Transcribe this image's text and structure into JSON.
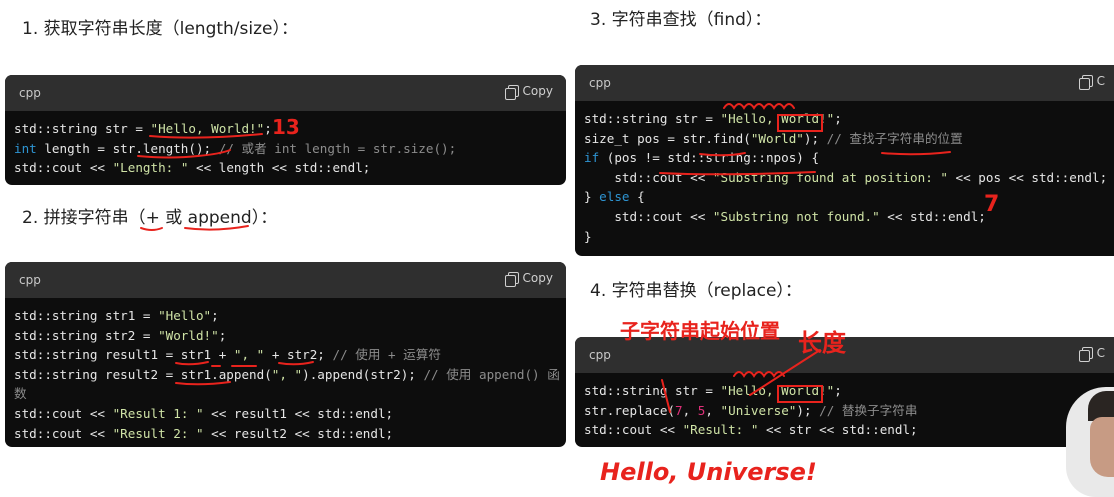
{
  "sections": [
    {
      "heading": "1. 获取字符串长度（length/size）：",
      "lang": "cpp",
      "copy": "Copy",
      "lines": [
        [
          [
            "std::string str = ",
            ""
          ],
          [
            "\"Hello, World!\"",
            "s2"
          ],
          [
            ";",
            ""
          ]
        ],
        [
          [
            "int",
            "kw"
          ],
          [
            " length = str.length(); ",
            ""
          ],
          [
            "// 或者 int length = str.size();",
            "cm"
          ]
        ],
        [
          [
            "std::cout << ",
            ""
          ],
          [
            "\"Length: \"",
            "s2"
          ],
          [
            " << length << std::endl;",
            ""
          ]
        ]
      ]
    },
    {
      "heading": "2. 拼接字符串（+ 或 append）：",
      "lang": "cpp",
      "copy": "Copy",
      "lines": [
        [
          [
            "std::string str1 = ",
            ""
          ],
          [
            "\"Hello\"",
            "s2"
          ],
          [
            ";",
            ""
          ]
        ],
        [
          [
            "std::string str2 = ",
            ""
          ],
          [
            "\"World!\"",
            "s2"
          ],
          [
            ";",
            ""
          ]
        ],
        [
          [
            "std::string result1 = str1 + ",
            ""
          ],
          [
            "\", \"",
            "s2"
          ],
          [
            " + str2; ",
            ""
          ],
          [
            "// 使用 + 运算符",
            "cm"
          ]
        ],
        [
          [
            "std::string result2 = str1.append(",
            ""
          ],
          [
            "\", \"",
            "s2"
          ],
          [
            ").append(str2); ",
            ""
          ],
          [
            "// 使用 append() 函",
            "cm"
          ]
        ],
        [
          [
            "数",
            "cm"
          ]
        ],
        [
          [
            "std::cout << ",
            ""
          ],
          [
            "\"Result 1: \"",
            "s2"
          ],
          [
            " << result1 << std::endl;",
            ""
          ]
        ],
        [
          [
            "std::cout << ",
            ""
          ],
          [
            "\"Result 2: \"",
            "s2"
          ],
          [
            " << result2 << std::endl;",
            ""
          ]
        ]
      ]
    },
    {
      "heading": "3. 字符串查找（find）：",
      "lang": "cpp",
      "copy": "C",
      "lines": [
        [
          [
            "std::string str = ",
            ""
          ],
          [
            "\"Hello, World!\"",
            "s2"
          ],
          [
            ";",
            ""
          ]
        ],
        [
          [
            "size_t pos = str.find(",
            ""
          ],
          [
            "\"World\"",
            "s2"
          ],
          [
            "); ",
            ""
          ],
          [
            "// 查找子字符串的位置",
            "cm"
          ]
        ],
        [
          [
            "if",
            "kw"
          ],
          [
            " (pos != std::string::npos) {",
            ""
          ]
        ],
        [
          [
            "    std::cout << ",
            ""
          ],
          [
            "\"Substring found at position: \"",
            "s2"
          ],
          [
            " << pos << std::endl;",
            ""
          ]
        ],
        [
          [
            "} ",
            ""
          ],
          [
            "else",
            "kw"
          ],
          [
            " {",
            ""
          ]
        ],
        [
          [
            "    std::cout << ",
            ""
          ],
          [
            "\"Substring not found.\"",
            "s2"
          ],
          [
            " << std::endl;",
            ""
          ]
        ],
        [
          [
            "}",
            ""
          ]
        ]
      ]
    },
    {
      "heading": "4. 字符串替换（replace）：",
      "lang": "cpp",
      "copy": "C",
      "lines": [
        [
          [
            "std::string str = ",
            ""
          ],
          [
            "\"Hello, World!\"",
            "s2"
          ],
          [
            ";",
            ""
          ]
        ],
        [
          [
            "str.replace(",
            ""
          ],
          [
            "7",
            "num"
          ],
          [
            ", ",
            ""
          ],
          [
            "5",
            "num"
          ],
          [
            ", ",
            ""
          ],
          [
            "\"Universe\"",
            "s2"
          ],
          [
            "); ",
            ""
          ],
          [
            "// 替换子字符串",
            "cm"
          ]
        ],
        [
          [
            "std::cout << ",
            ""
          ],
          [
            "\"Result: \"",
            "s2"
          ],
          [
            " << str << std::endl;",
            ""
          ]
        ]
      ]
    }
  ],
  "annotations": {
    "len_result": "13",
    "find_result": "7",
    "substr_start": "子字符串起始位置",
    "count": "长度",
    "replaced": "Hello, Universe!"
  },
  "colors": {
    "ink": "#e8231d",
    "code_bg": "#0d0d0d",
    "code_header": "#2f2f2f",
    "string": "#cfe3a6",
    "keyword": "#2e95d3"
  }
}
